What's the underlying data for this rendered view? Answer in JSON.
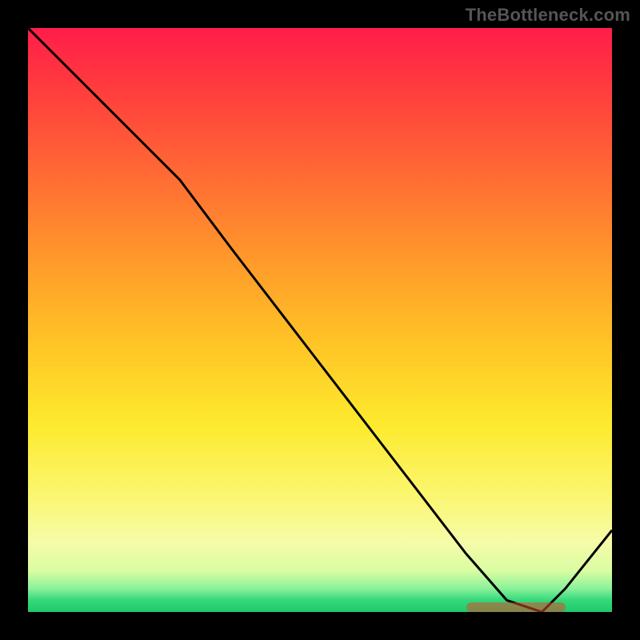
{
  "watermark": "TheBottleneck.com",
  "colors": {
    "curve_stroke": "#000000",
    "marker_fill": "#d84a2b",
    "background": "#000000"
  },
  "chart_data": {
    "type": "line",
    "title": "",
    "xlabel": "",
    "ylabel": "",
    "xlim": [
      0,
      100
    ],
    "ylim": [
      0,
      100
    ],
    "note": "No axis ticks or numeric labels are rendered in the image; x positions are expressed as percentage of plot width and y as percentage of plot height (0 = bottom, 100 = top). Values are read from the curve shape.",
    "x": [
      0,
      10,
      20,
      26,
      35,
      45,
      55,
      65,
      75,
      82,
      88,
      92,
      100
    ],
    "values": [
      100,
      90,
      80,
      74,
      62,
      49,
      36,
      23,
      10,
      2,
      0,
      4,
      14
    ],
    "marker_region": {
      "x_start_pct": 75,
      "x_end_pct": 92,
      "y_pct": 0.8,
      "label": "highlighted optimal region along x-axis"
    },
    "background_gradient": {
      "top_color": "#ff1d4a",
      "bottom_color": "#1ec96a",
      "description": "vertical red→yellow→green gradient indicating bottleneck severity, green at bottom"
    }
  }
}
